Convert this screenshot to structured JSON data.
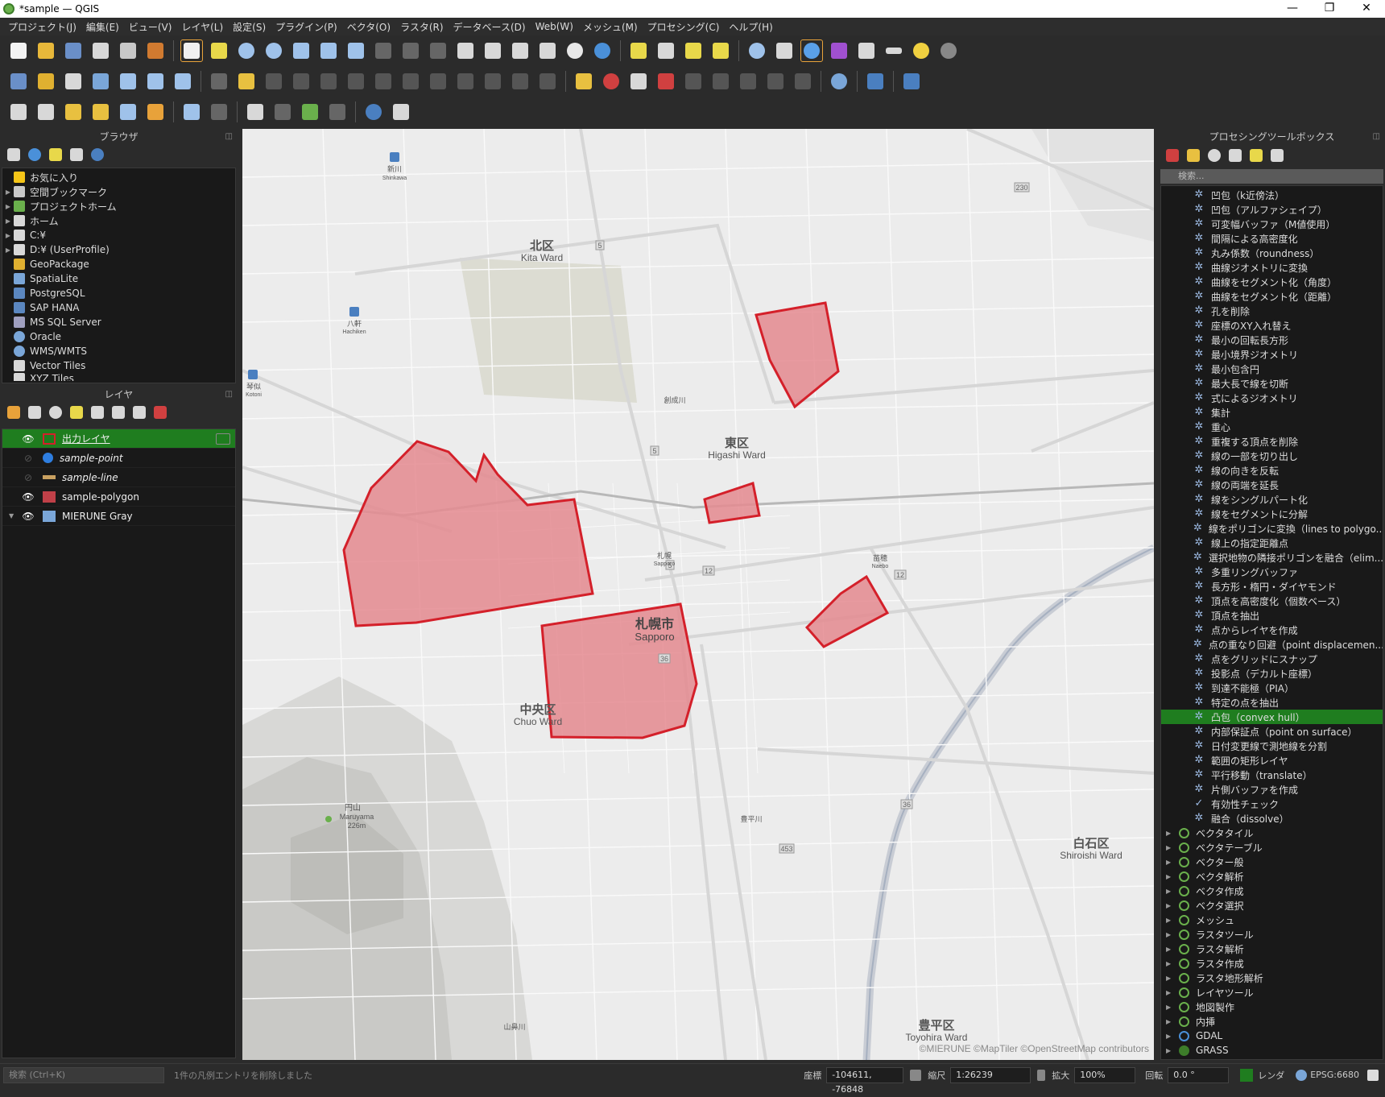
{
  "window": {
    "title": "*sample — QGIS",
    "controls": [
      "—",
      "❐",
      "✕"
    ]
  },
  "menu": [
    "プロジェクト(J)",
    "編集(E)",
    "ビュー(V)",
    "レイヤ(L)",
    "設定(S)",
    "プラグイン(P)",
    "ベクタ(O)",
    "ラスタ(R)",
    "データベース(D)",
    "Web(W)",
    "メッシュ(M)",
    "プロセシング(C)",
    "ヘルプ(H)"
  ],
  "browser": {
    "title": "ブラウザ",
    "items": [
      {
        "label": "お気に入り",
        "icon": "star-icon",
        "color": "#f5c518"
      },
      {
        "label": "空間ブックマーク",
        "icon": "bookmark-icon",
        "color": "#c9c9c9"
      },
      {
        "label": "プロジェクトホーム",
        "icon": "project-home-icon",
        "color": "#6ab04c"
      },
      {
        "label": "ホーム",
        "icon": "home-folder-icon",
        "color": "#d8d8d8"
      },
      {
        "label": "C:¥",
        "icon": "drive-icon",
        "color": "#d8d8d8"
      },
      {
        "label": "D:¥ (UserProfile)",
        "icon": "folder-icon",
        "color": "#d8d8d8"
      },
      {
        "label": "GeoPackage",
        "icon": "geopackage-icon",
        "color": "#e0b030"
      },
      {
        "label": "SpatiaLite",
        "icon": "spatialite-icon",
        "color": "#7aa6d8"
      },
      {
        "label": "PostgreSQL",
        "icon": "postgresql-icon",
        "color": "#5b87c0"
      },
      {
        "label": "SAP HANA",
        "icon": "sap-hana-icon",
        "color": "#5b87c0"
      },
      {
        "label": "MS SQL Server",
        "icon": "mssql-icon",
        "color": "#a0a0c0"
      },
      {
        "label": "Oracle",
        "icon": "oracle-icon",
        "color": "#7aa6d8"
      },
      {
        "label": "WMS/WMTS",
        "icon": "wms-icon",
        "color": "#7aa6d8"
      },
      {
        "label": "Vector Tiles",
        "icon": "vector-tiles-icon",
        "color": "#d8d8d8"
      },
      {
        "label": "XYZ Tiles",
        "icon": "xyz-tiles-icon",
        "color": "#d8d8d8"
      }
    ]
  },
  "layers": {
    "title": "レイヤ",
    "items": [
      {
        "label": "出力レイヤ",
        "visible": true,
        "selected": true
      },
      {
        "label": "sample-point",
        "visible": false
      },
      {
        "label": "sample-line",
        "visible": false
      },
      {
        "label": "sample-polygon",
        "visible": true
      },
      {
        "label": "MIERUNE Gray",
        "visible": true
      }
    ]
  },
  "map": {
    "labels": {
      "kita_jp": "北区",
      "kita_en": "Kita Ward",
      "higashi_jp": "東区",
      "higashi_en": "Higashi Ward",
      "sapporo_jp": "札幌市",
      "sapporo_en": "Sapporo",
      "chuo_jp": "中央区",
      "chuo_en": "Chuo Ward",
      "shiroishi_jp": "白石区",
      "shiroishi_en": "Shiroishi Ward",
      "toyohira_jp": "豊平区",
      "toyohira_en": "Toyohira Ward",
      "maruyama": "円山",
      "maruyama_en": "Maruyama",
      "maruyama_h": "226m",
      "shinkawa": "新川",
      "shinkawa_en": "Shinkawa",
      "hachiken": "八軒",
      "hachiken_en": "Hachiken",
      "kotoni": "琴似",
      "kotoni_en": "Kotoni",
      "sapporo_st": "札幌",
      "sapporo_st_en": "Sapporo",
      "naebo": "苗穂",
      "naebo_en": "Naebo",
      "r5a": "5",
      "r5b": "5",
      "r5c": "5",
      "r12a": "12",
      "r12b": "12",
      "r36a": "36",
      "r36b": "36",
      "r453": "453",
      "r230": "230",
      "river1": "創成川",
      "river2": "豊平川",
      "river3": "山鼻川"
    },
    "attribution": "©MIERUNE ©MapTiler ©OpenStreetMap contributors"
  },
  "toolbox": {
    "title": "プロセシングツールボックス",
    "search_placeholder": "検索...",
    "tools": [
      "凹包（k近傍法）",
      "凹包（アルファシェイプ）",
      "可変幅バッファ（M値使用）",
      "間隔による高密度化",
      "丸み係数（roundness）",
      "曲線ジオメトリに変換",
      "曲線をセグメント化（角度）",
      "曲線をセグメント化（距離）",
      "孔を削除",
      "座標のXY入れ替え",
      "最小の回転長方形",
      "最小境界ジオメトリ",
      "最小包含円",
      "最大長で線を切断",
      "式によるジオメトリ",
      "集計",
      "重心",
      "重複する頂点を削除",
      "線の一部を切り出し",
      "線の向きを反転",
      "線の両端を延長",
      "線をシングルパート化",
      "線をセグメントに分解",
      "線をポリゴンに変換（lines to polygo...",
      "線上の指定距離点",
      "選択地物の隣接ポリゴンを融合（elim...",
      "多重リングバッファ",
      "長方形・楕円・ダイヤモンド",
      "頂点を高密度化（個数ベース）",
      "頂点を抽出",
      "点からレイヤを作成",
      "点の重なり回避（point displacemen...",
      "点をグリッドにスナップ",
      "投影点（デカルト座標）",
      "到達不能極（PIA）",
      "特定の点を抽出",
      "凸包（convex hull）",
      "内部保証点（point on surface）",
      "日付変更線で測地線を分割",
      "範囲の矩形レイヤ",
      "平行移動（translate）",
      "片側バッファを作成",
      "有効性チェック",
      "融合（dissolve）"
    ],
    "selected_tool": "凸包（convex hull）",
    "groups": [
      "ベクタタイル",
      "ベクタテーブル",
      "ベクター般",
      "ベクタ解析",
      "ベクタ作成",
      "ベクタ選択",
      "メッシュ",
      "ラスタツール",
      "ラスタ解析",
      "ラスタ作成",
      "ラスタ地形解析",
      "レイヤツール",
      "地図製作",
      "内挿",
      "GDAL",
      "GRASS"
    ]
  },
  "status": {
    "search_placeholder": "検索 (Ctrl+K)",
    "message": "1件の凡例エントリを削除しました",
    "coord_label": "座標",
    "coord_value": "-104611, -76848",
    "scale_label": "縮尺",
    "scale_value": "1:26239",
    "magnifier_label": "拡大",
    "magnifier_value": "100%",
    "rotation_label": "回転",
    "rotation_value": "0.0 °",
    "render_label": "レンダ",
    "crs": "EPSG:6680"
  },
  "colors": {
    "accent_green": "#1f7d1f",
    "polygon_fill": "#e48a8f",
    "polygon_stroke": "#d4202a"
  }
}
